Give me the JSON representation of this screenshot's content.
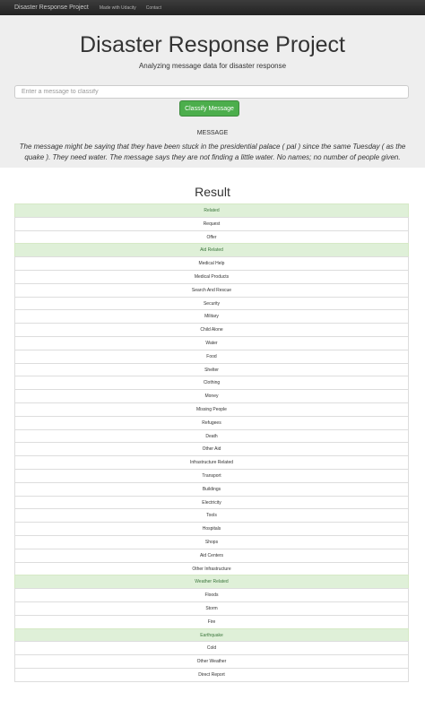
{
  "navbar": {
    "brand": "Disaster Response Project",
    "links": [
      "Made with Udacity",
      "Contact"
    ]
  },
  "header": {
    "title": "Disaster Response Project",
    "subtitle": "Analyzing message data for disaster response"
  },
  "form": {
    "placeholder": "Enter a message to classify",
    "button_label": "Classify Message"
  },
  "message": {
    "label": "MESSAGE",
    "text": "The message might be saying that they have been stuck in the presidential palace ( pal ) since the same Tuesday ( as the quake ). They need water. The message says they are not finding a little water. No names; no number of people given."
  },
  "result": {
    "heading": "Result",
    "colors": {
      "positive_bg": "#dff0d8",
      "positive_text": "#3c763d"
    },
    "categories": [
      {
        "label": "Related",
        "positive": true
      },
      {
        "label": "Request",
        "positive": false
      },
      {
        "label": "Offer",
        "positive": false
      },
      {
        "label": "Aid Related",
        "positive": true
      },
      {
        "label": "Medical Help",
        "positive": false
      },
      {
        "label": "Medical Products",
        "positive": false
      },
      {
        "label": "Search And Rescue",
        "positive": false
      },
      {
        "label": "Security",
        "positive": false
      },
      {
        "label": "Military",
        "positive": false
      },
      {
        "label": "Child Alone",
        "positive": false
      },
      {
        "label": "Water",
        "positive": false
      },
      {
        "label": "Food",
        "positive": false
      },
      {
        "label": "Shelter",
        "positive": false
      },
      {
        "label": "Clothing",
        "positive": false
      },
      {
        "label": "Money",
        "positive": false
      },
      {
        "label": "Missing People",
        "positive": false
      },
      {
        "label": "Refugees",
        "positive": false
      },
      {
        "label": "Death",
        "positive": false
      },
      {
        "label": "Other Aid",
        "positive": false
      },
      {
        "label": "Infrastructure Related",
        "positive": false
      },
      {
        "label": "Transport",
        "positive": false
      },
      {
        "label": "Buildings",
        "positive": false
      },
      {
        "label": "Electricity",
        "positive": false
      },
      {
        "label": "Tools",
        "positive": false
      },
      {
        "label": "Hospitals",
        "positive": false
      },
      {
        "label": "Shops",
        "positive": false
      },
      {
        "label": "Aid Centers",
        "positive": false
      },
      {
        "label": "Other Infrastructure",
        "positive": false
      },
      {
        "label": "Weather Related",
        "positive": true
      },
      {
        "label": "Floods",
        "positive": false
      },
      {
        "label": "Storm",
        "positive": false
      },
      {
        "label": "Fire",
        "positive": false
      },
      {
        "label": "Earthquake",
        "positive": true
      },
      {
        "label": "Cold",
        "positive": false
      },
      {
        "label": "Other Weather",
        "positive": false
      },
      {
        "label": "Direct Report",
        "positive": false
      }
    ]
  }
}
